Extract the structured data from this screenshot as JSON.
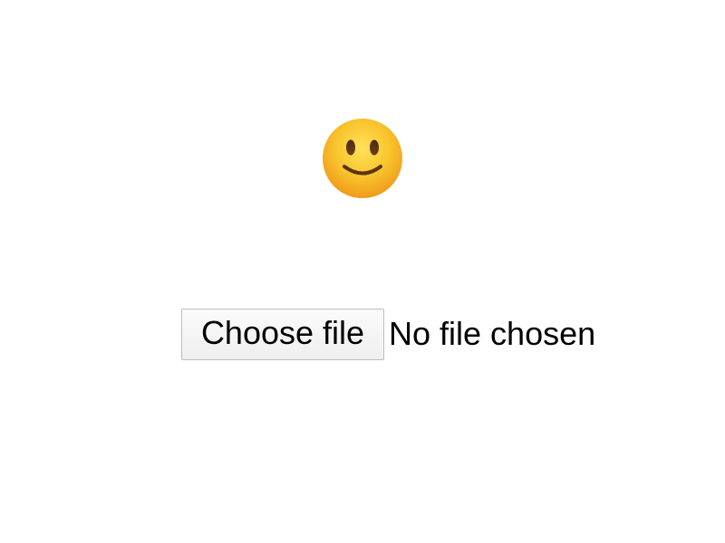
{
  "emoji": {
    "icon": "slightly-smiling-face-icon",
    "colors": {
      "face": "#f7c12c",
      "face_dark": "#f09a1a",
      "features": "#5a3514"
    }
  },
  "file_input": {
    "button_label": "Choose file",
    "status_text": "No file chosen"
  }
}
